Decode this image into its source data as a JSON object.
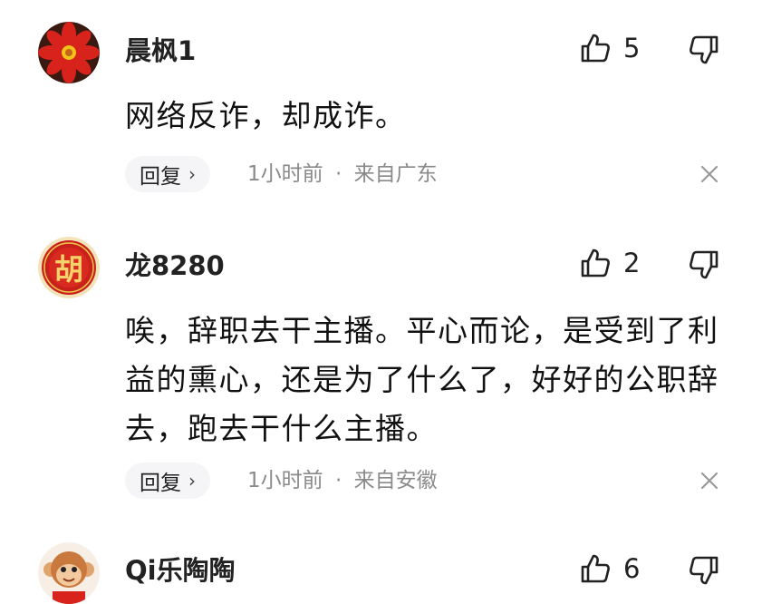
{
  "comments": [
    {
      "username": "晨枫1",
      "avatar_icon": "red-flower-avatar",
      "text": "网络反诈，却成诈。",
      "likes": "5",
      "reply_label": "回复",
      "time": "1小时前",
      "separator": "·",
      "location": "来自广东"
    },
    {
      "username": "龙8280",
      "avatar_icon": "hu-character-avatar",
      "avatar_char": "胡",
      "text": "唉，辞职去干主播。平心而论，是受到了利益的熏心，还是为了什么了，好好的公职辞去，跑去干什么主播。",
      "likes": "2",
      "reply_label": "回复",
      "time": "1小时前",
      "separator": "·",
      "location": "来自安徽"
    },
    {
      "username": "Qi乐陶陶",
      "avatar_icon": "monkey-cartoon-avatar",
      "likes": "6"
    }
  ],
  "colors": {
    "background": "#ffffff",
    "meta_text": "#8a8a8a",
    "reply_bg": "#f5f5f7",
    "icon_stroke": "#222222"
  }
}
